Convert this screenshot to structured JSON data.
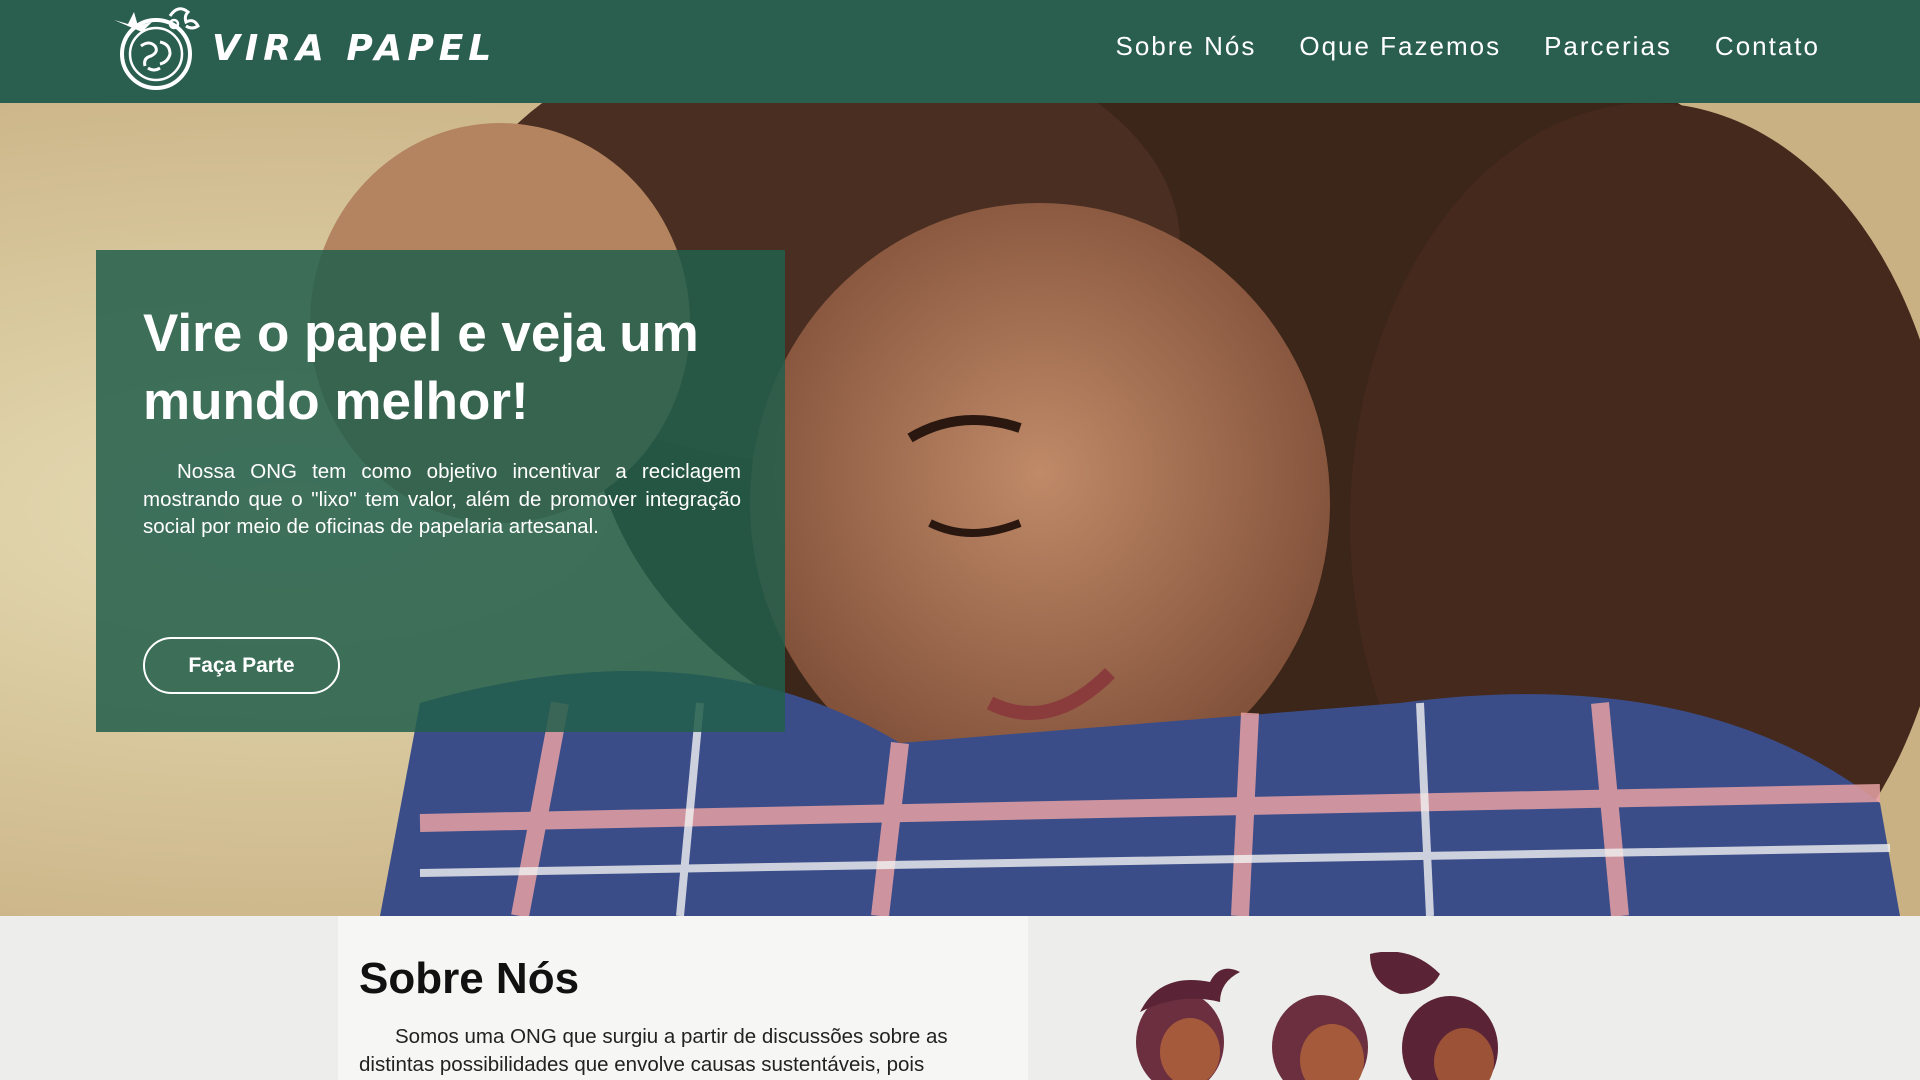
{
  "brand": {
    "name": "VIRA PAPEL",
    "primary_color": "#2a5e4e",
    "logo_icon": "globe-with-bird-logo"
  },
  "nav": {
    "items": [
      {
        "label": "Sobre Nós"
      },
      {
        "label": "Oque Fazemos"
      },
      {
        "label": "Parcerias"
      },
      {
        "label": "Contato"
      }
    ]
  },
  "hero": {
    "title": "Vire o papel e veja um mundo melhor!",
    "text": "Nossa ONG tem como objetivo incentivar a reciclagem mostrando que o \"lixo\" tem valor, além de promover integração social por meio de oficinas de papelaria artesanal.",
    "button_label": "Faça Parte",
    "image": "smiling-girl-curly-hair-plaid-shirt-photo"
  },
  "about": {
    "title": "Sobre Nós",
    "text": "Somos uma ONG que surgiu a partir de discussões sobre as distintas possibilidades que envolve causas sustentáveis, pois",
    "illustration": "three-people-illustration"
  }
}
